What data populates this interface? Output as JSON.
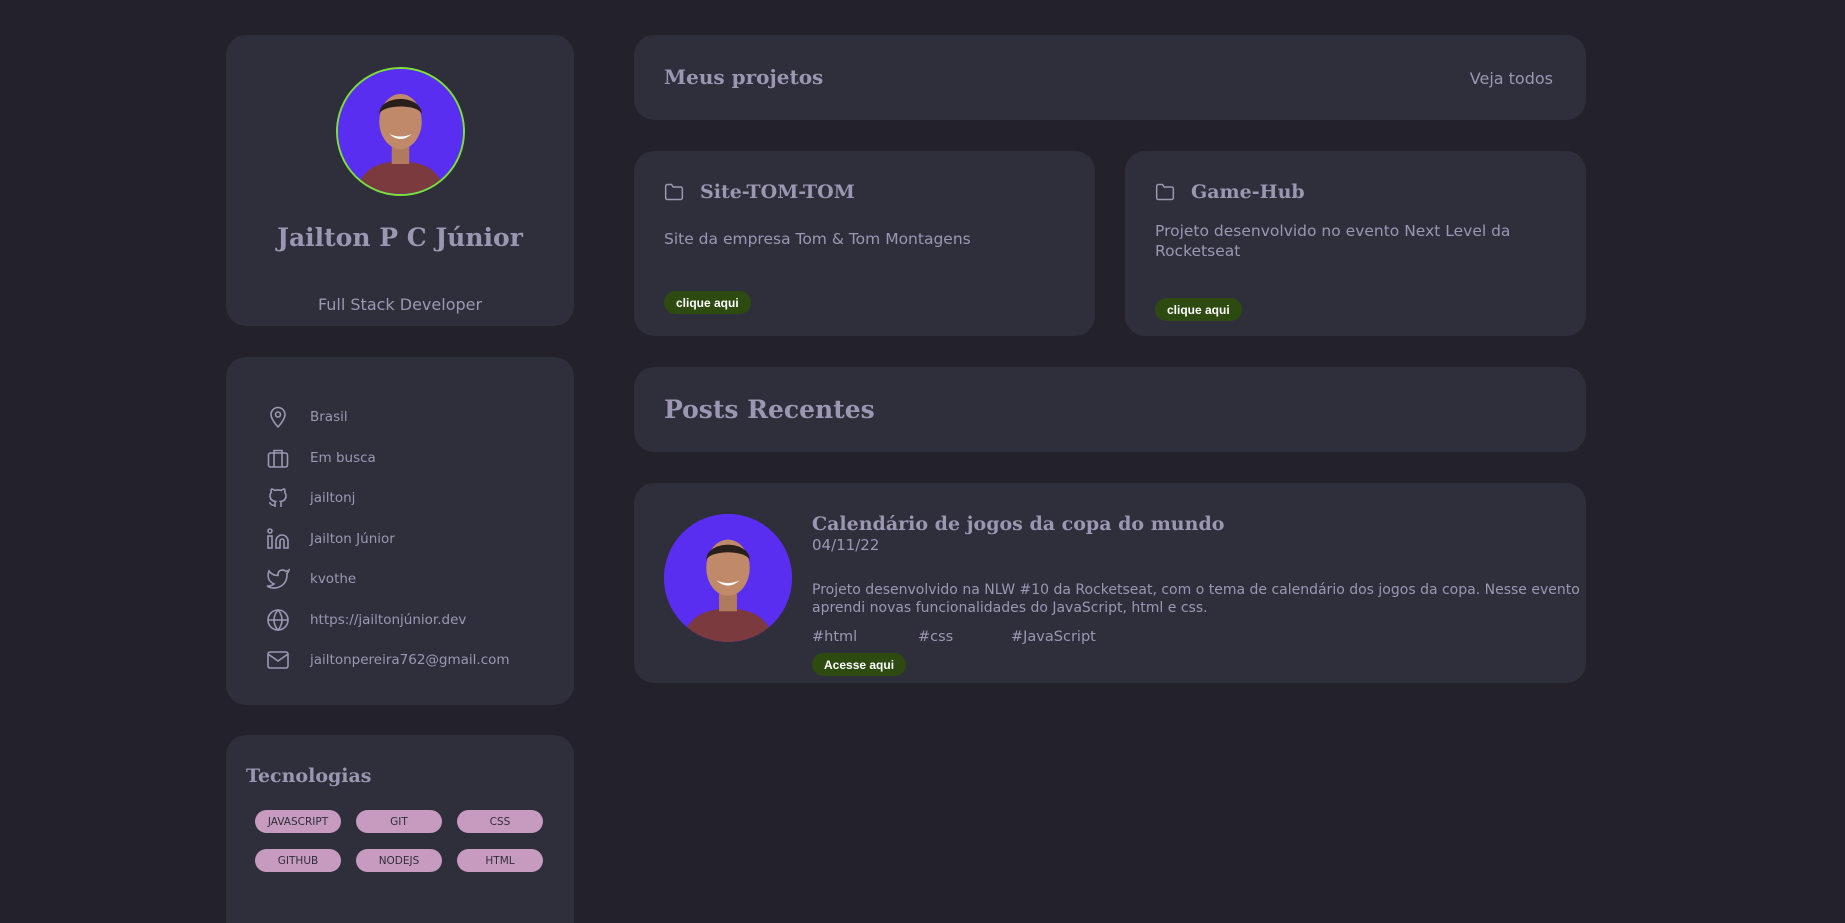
{
  "profile": {
    "name": "Jailton P C Júnior",
    "role": "Full Stack Developer",
    "ring_color": "#7be03a",
    "avatar_bg": "#5a2ef0"
  },
  "contacts": [
    {
      "icon": "location-pin-icon",
      "label": "Brasil"
    },
    {
      "icon": "briefcase-icon",
      "label": "Em busca"
    },
    {
      "icon": "github-icon",
      "label": "jailtonj"
    },
    {
      "icon": "linkedin-icon",
      "label": "Jailton Júnior"
    },
    {
      "icon": "twitter-icon",
      "label": "kvothe"
    },
    {
      "icon": "globe-icon",
      "label": "https://jailtonjúnior.dev"
    },
    {
      "icon": "mail-icon",
      "label": "jailtonpereira762@gmail.com"
    }
  ],
  "tech": {
    "title": "Tecnologias",
    "tags": [
      "JAVASCRIPT",
      "GIT",
      "CSS",
      "GITHUB",
      "NODEJS",
      "HTML"
    ]
  },
  "projects_header": {
    "title": "Meus projetos",
    "see_all": "Veja todos"
  },
  "projects": [
    {
      "icon": "folder-icon",
      "title": "Site-TOM-TOM",
      "description": "Site da empresa Tom & Tom Montagens",
      "button": "clique aqui"
    },
    {
      "icon": "folder-icon",
      "title": "Game-Hub",
      "description": "Projeto desenvolvido no evento Next Level da Rocketseat",
      "button": "clique aqui"
    }
  ],
  "posts_header": {
    "title": "Posts Recentes"
  },
  "post": {
    "title": "Calendário de jogos da copa do mundo",
    "date": "04/11/22",
    "description": "Projeto desenvolvido na NLW #10 da Rocketseat, com o tema de calendário dos jogos da copa. Nesse evento aprendi novas funcionalidades do JavaScript, html e css.",
    "hashtags": [
      "#html",
      "#css",
      "#JavaScript"
    ],
    "button": "Acesse aqui"
  },
  "colors": {
    "background": "#23222b",
    "card": "#2f2e3b",
    "text": "#9b97b3",
    "tag": "#c79bbf",
    "button": "#2d4a10"
  }
}
